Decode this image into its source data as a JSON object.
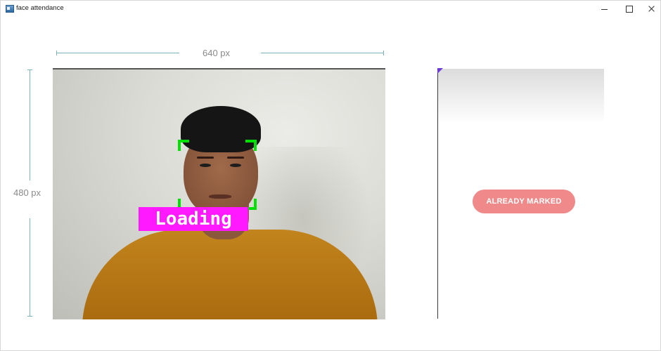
{
  "window": {
    "title": "face attendance",
    "controls": [
      "minimize",
      "maximize",
      "close"
    ]
  },
  "dimensions": {
    "width_label": "640 px",
    "height_label": "480 px"
  },
  "camera": {
    "overlay_label": "Loading",
    "overlay_color": "#ff19ff",
    "face_box_color": "#00e000"
  },
  "status_panel": {
    "status_label": "ALREADY MARKED",
    "status_color": "#f08a8a"
  }
}
